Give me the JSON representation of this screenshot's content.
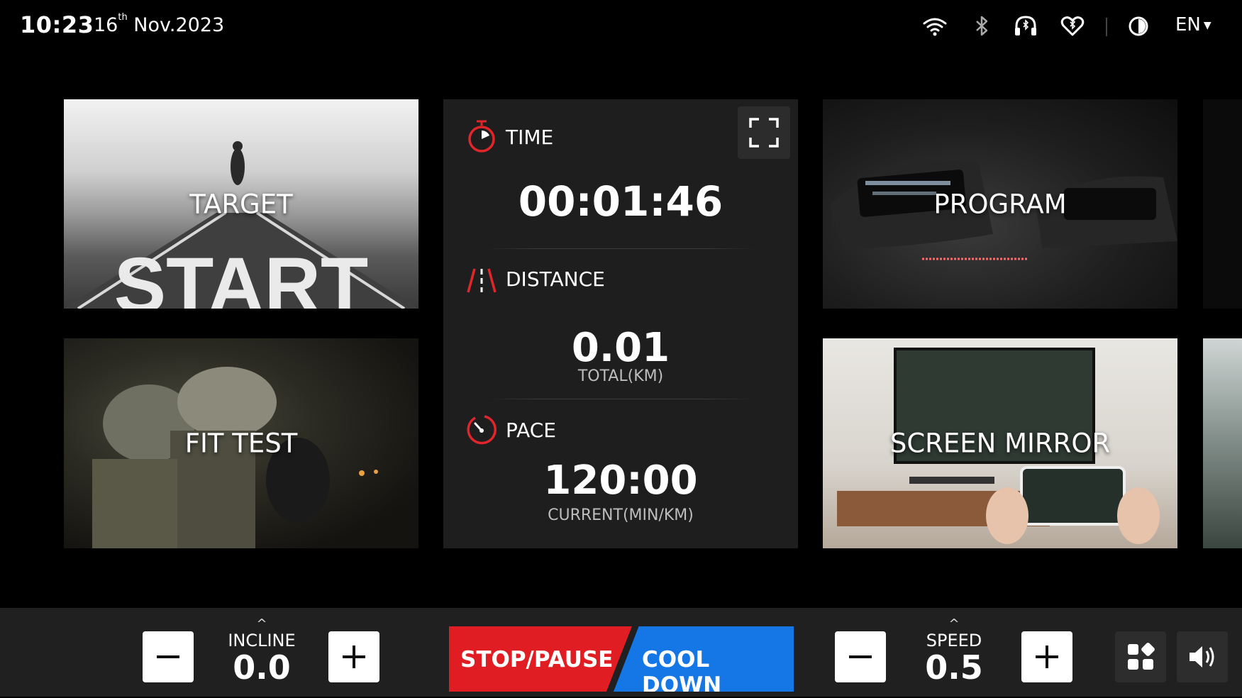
{
  "status_bar": {
    "time": "10:23",
    "date_day": "16",
    "date_suffix": "th",
    "date_rest": "Nov.2023",
    "icons": [
      "wifi-icon",
      "bluetooth-icon",
      "headphones-icon",
      "heart-rate-icon",
      "brightness-icon"
    ],
    "language": "EN"
  },
  "tiles": {
    "target": "TARGET",
    "fit_test": "FIT TEST",
    "program": "PROGRAM",
    "screen_mirror": "SCREEN MIRROR",
    "start_road_text": "START"
  },
  "stats": {
    "time_label": "TIME",
    "time_value": "00:01:46",
    "distance_label": "DISTANCE",
    "distance_value": "0.01",
    "distance_unit": "TOTAL(KM)",
    "pace_label": "PACE",
    "pace_value": "120:00",
    "pace_unit": "CURRENT(MIN/KM)",
    "accent": "#e0262b"
  },
  "controls": {
    "incline_label": "INCLINE",
    "incline_value": "0.0",
    "speed_label": "SPEED",
    "speed_value": "0.5",
    "stop_label": "STOP/PAUSE",
    "cooldown_label": "COOL DOWN",
    "stop_color": "#e01d22",
    "cooldown_color": "#1577e6"
  }
}
